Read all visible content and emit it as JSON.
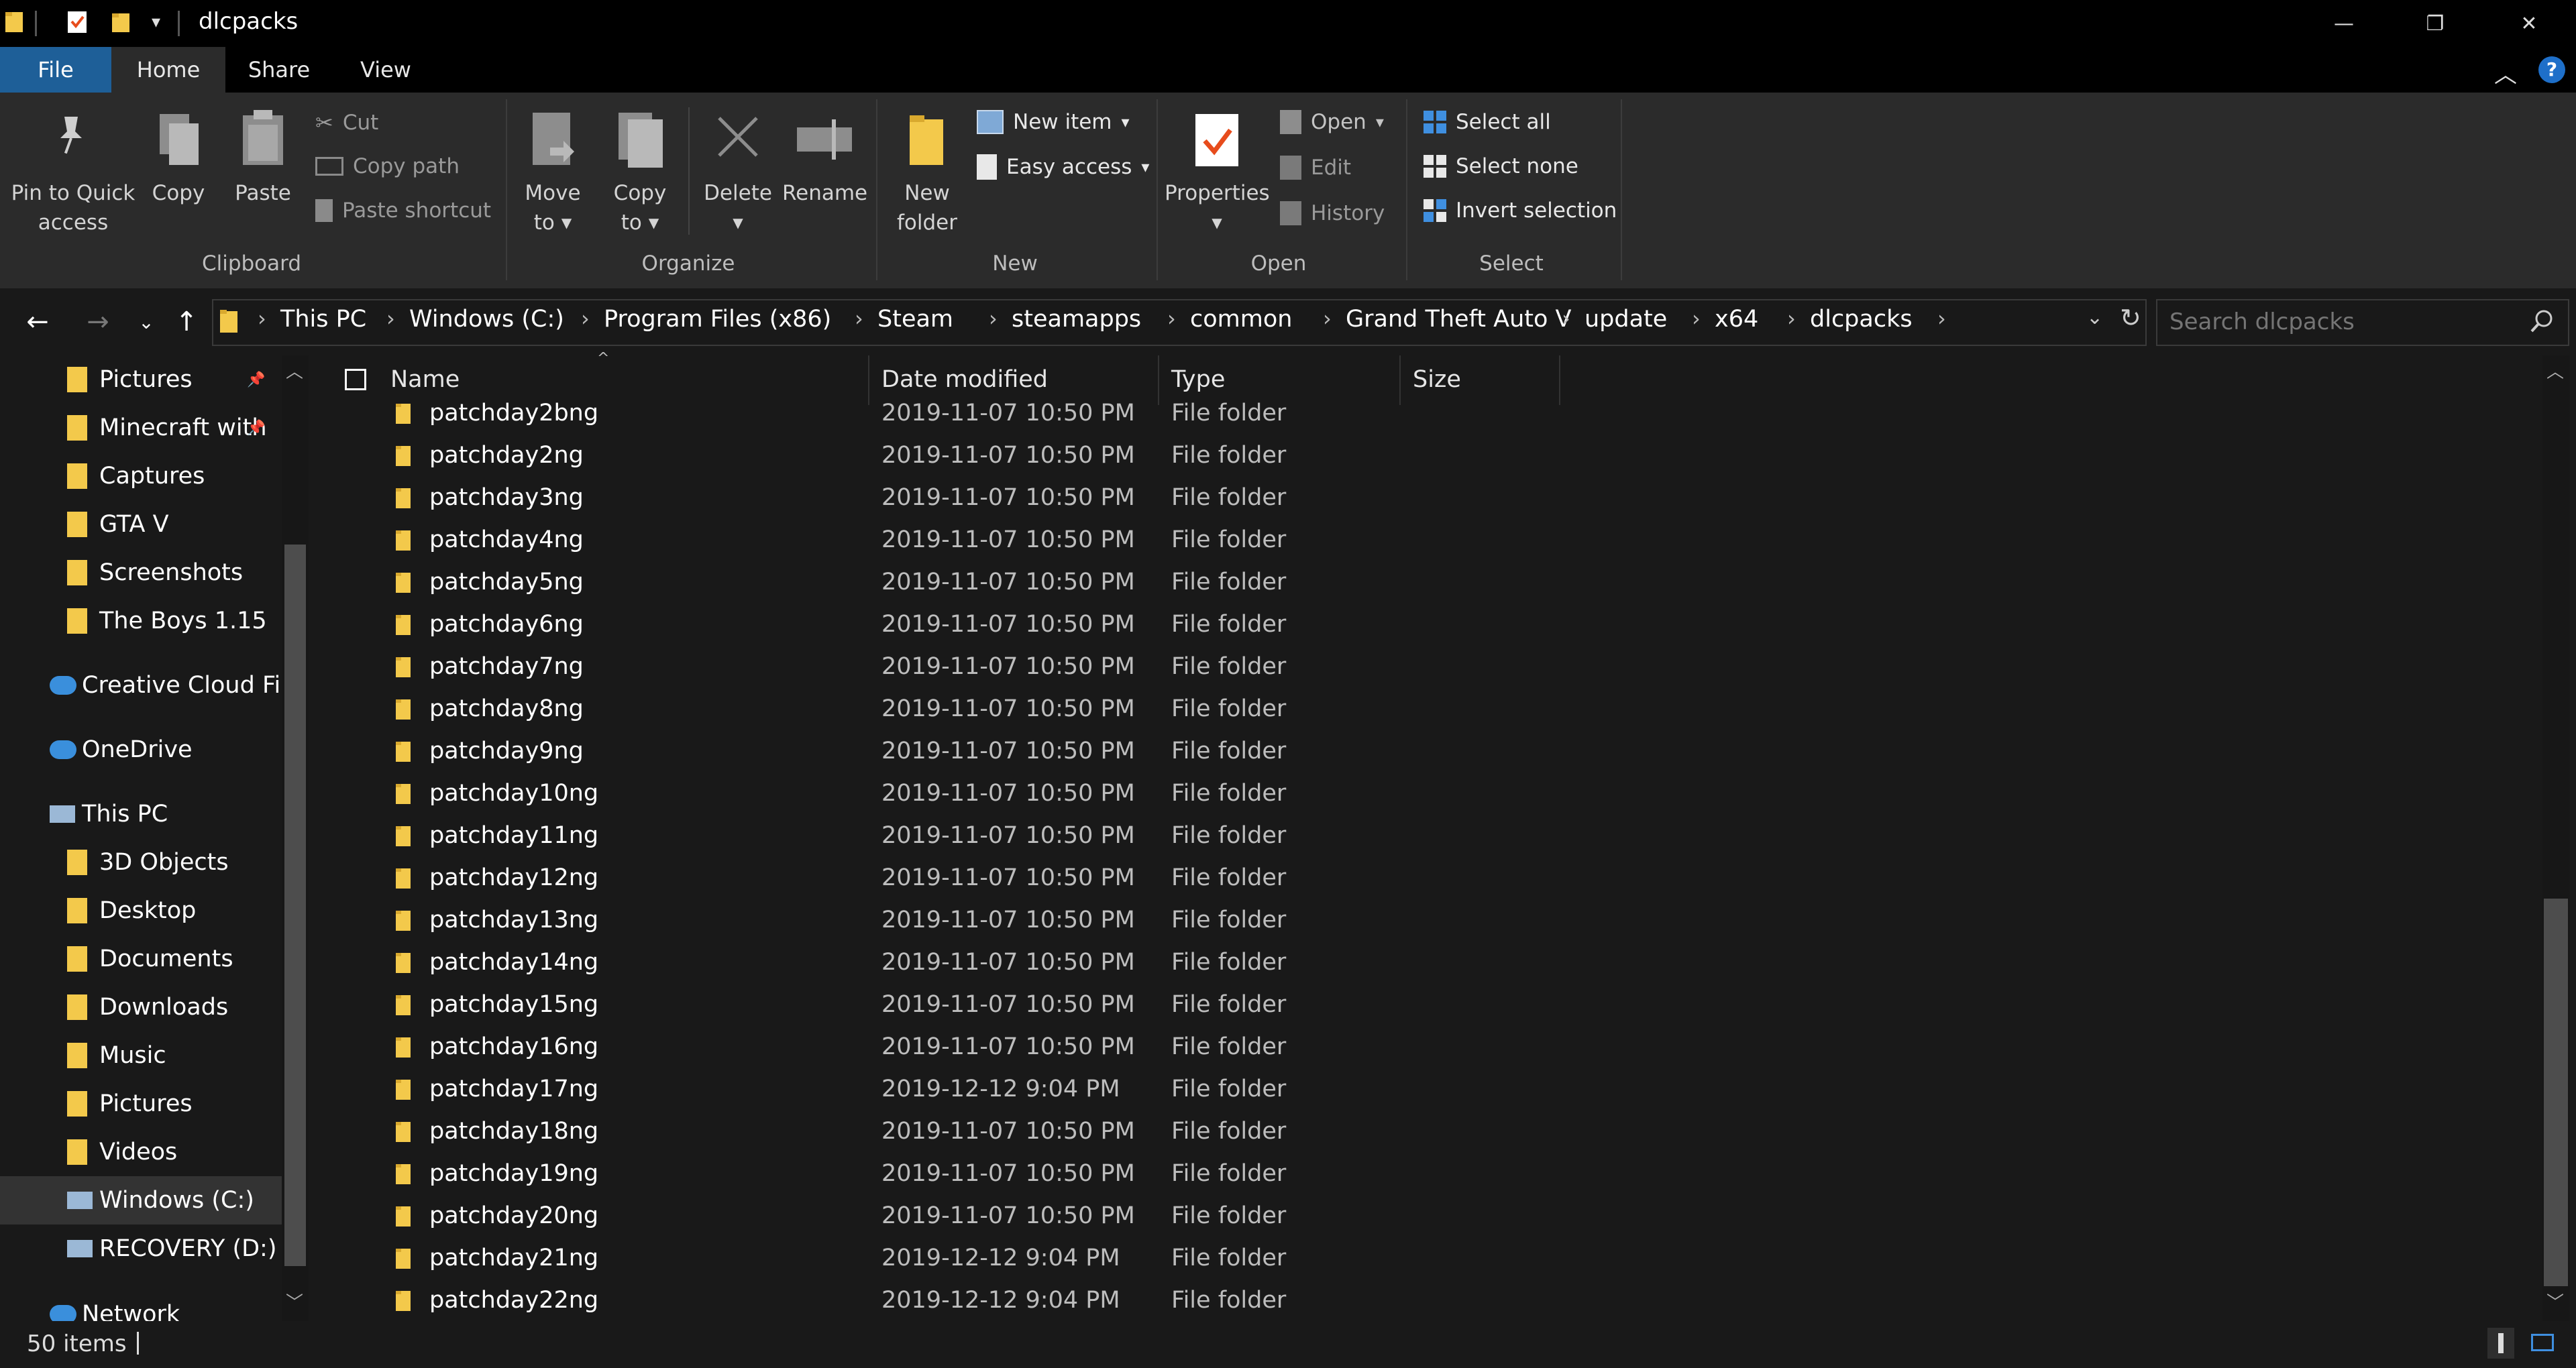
{
  "window": {
    "title": "dlcpacks"
  },
  "ribbon_tabs": {
    "file": "File",
    "home": "Home",
    "share": "Share",
    "view": "View"
  },
  "ribbon": {
    "clipboard": {
      "label": "Clipboard",
      "pin": "Pin to Quick access",
      "pin_line1": "Pin to Quick",
      "pin_line2": "access",
      "copy": "Copy",
      "paste": "Paste",
      "cut": "Cut",
      "copy_path": "Copy path",
      "paste_shortcut": "Paste shortcut"
    },
    "organize": {
      "label": "Organize",
      "move_to_line1": "Move",
      "move_to_line2": "to",
      "copy_to_line1": "Copy",
      "copy_to_line2": "to",
      "delete": "Delete",
      "rename": "Rename"
    },
    "new": {
      "label": "New",
      "new_folder_line1": "New",
      "new_folder_line2": "folder",
      "new_item": "New item",
      "easy_access": "Easy access"
    },
    "open": {
      "label": "Open",
      "properties": "Properties",
      "open": "Open",
      "edit": "Edit",
      "history": "History"
    },
    "select": {
      "label": "Select",
      "select_all": "Select all",
      "select_none": "Select none",
      "invert_selection": "Invert selection"
    }
  },
  "breadcrumb": [
    "This PC",
    "Windows (C:)",
    "Program Files (x86)",
    "Steam",
    "steamapps",
    "common",
    "Grand Theft Auto V",
    "update",
    "x64",
    "dlcpacks"
  ],
  "search": {
    "placeholder": "Search dlcpacks"
  },
  "sidebar": [
    {
      "label": "Pictures",
      "icon": "pictures-folder-icon",
      "pinned": true
    },
    {
      "label": "Minecraft with",
      "icon": "folder-icon",
      "pinned": true
    },
    {
      "label": "Captures",
      "icon": "folder-icon"
    },
    {
      "label": "GTA V",
      "icon": "folder-icon"
    },
    {
      "label": "Screenshots",
      "icon": "folder-icon"
    },
    {
      "label": "The Boys 1.15",
      "icon": "folder-icon"
    },
    {
      "label": "Creative Cloud Files",
      "icon": "creative-cloud-icon"
    },
    {
      "label": "OneDrive",
      "icon": "onedrive-cloud-icon"
    },
    {
      "label": "This PC",
      "icon": "computer-icon"
    },
    {
      "label": "3D Objects",
      "icon": "3d-objects-icon"
    },
    {
      "label": "Desktop",
      "icon": "desktop-folder-icon"
    },
    {
      "label": "Documents",
      "icon": "documents-folder-icon"
    },
    {
      "label": "Downloads",
      "icon": "downloads-folder-icon"
    },
    {
      "label": "Music",
      "icon": "music-folder-icon"
    },
    {
      "label": "Pictures",
      "icon": "pictures-folder-icon"
    },
    {
      "label": "Videos",
      "icon": "videos-folder-icon"
    },
    {
      "label": "Windows (C:)",
      "icon": "drive-icon",
      "selected": true
    },
    {
      "label": "RECOVERY (D:)",
      "icon": "drive-icon"
    },
    {
      "label": "Network",
      "icon": "network-icon"
    }
  ],
  "columns": {
    "name": "Name",
    "date": "Date modified",
    "type": "Type",
    "size": "Size"
  },
  "files": [
    {
      "name": "patchday2bng",
      "date": "2019-11-07 10:50 PM",
      "type": "File folder"
    },
    {
      "name": "patchday2ng",
      "date": "2019-11-07 10:50 PM",
      "type": "File folder"
    },
    {
      "name": "patchday3ng",
      "date": "2019-11-07 10:50 PM",
      "type": "File folder"
    },
    {
      "name": "patchday4ng",
      "date": "2019-11-07 10:50 PM",
      "type": "File folder"
    },
    {
      "name": "patchday5ng",
      "date": "2019-11-07 10:50 PM",
      "type": "File folder"
    },
    {
      "name": "patchday6ng",
      "date": "2019-11-07 10:50 PM",
      "type": "File folder"
    },
    {
      "name": "patchday7ng",
      "date": "2019-11-07 10:50 PM",
      "type": "File folder"
    },
    {
      "name": "patchday8ng",
      "date": "2019-11-07 10:50 PM",
      "type": "File folder"
    },
    {
      "name": "patchday9ng",
      "date": "2019-11-07 10:50 PM",
      "type": "File folder"
    },
    {
      "name": "patchday10ng",
      "date": "2019-11-07 10:50 PM",
      "type": "File folder"
    },
    {
      "name": "patchday11ng",
      "date": "2019-11-07 10:50 PM",
      "type": "File folder"
    },
    {
      "name": "patchday12ng",
      "date": "2019-11-07 10:50 PM",
      "type": "File folder"
    },
    {
      "name": "patchday13ng",
      "date": "2019-11-07 10:50 PM",
      "type": "File folder"
    },
    {
      "name": "patchday14ng",
      "date": "2019-11-07 10:50 PM",
      "type": "File folder"
    },
    {
      "name": "patchday15ng",
      "date": "2019-11-07 10:50 PM",
      "type": "File folder"
    },
    {
      "name": "patchday16ng",
      "date": "2019-11-07 10:50 PM",
      "type": "File folder"
    },
    {
      "name": "patchday17ng",
      "date": "2019-12-12 9:04 PM",
      "type": "File folder"
    },
    {
      "name": "patchday18ng",
      "date": "2019-11-07 10:50 PM",
      "type": "File folder"
    },
    {
      "name": "patchday19ng",
      "date": "2019-11-07 10:50 PM",
      "type": "File folder"
    },
    {
      "name": "patchday20ng",
      "date": "2019-11-07 10:50 PM",
      "type": "File folder"
    },
    {
      "name": "patchday21ng",
      "date": "2019-12-12 9:04 PM",
      "type": "File folder"
    },
    {
      "name": "patchday22ng",
      "date": "2019-12-12 9:04 PM",
      "type": "File folder"
    }
  ],
  "status": {
    "item_count": "50 items"
  },
  "colors": {
    "accent": "#1e5f98",
    "folder": "#f3c94b",
    "background": "#191919",
    "ribbon": "#2b2b2b"
  }
}
